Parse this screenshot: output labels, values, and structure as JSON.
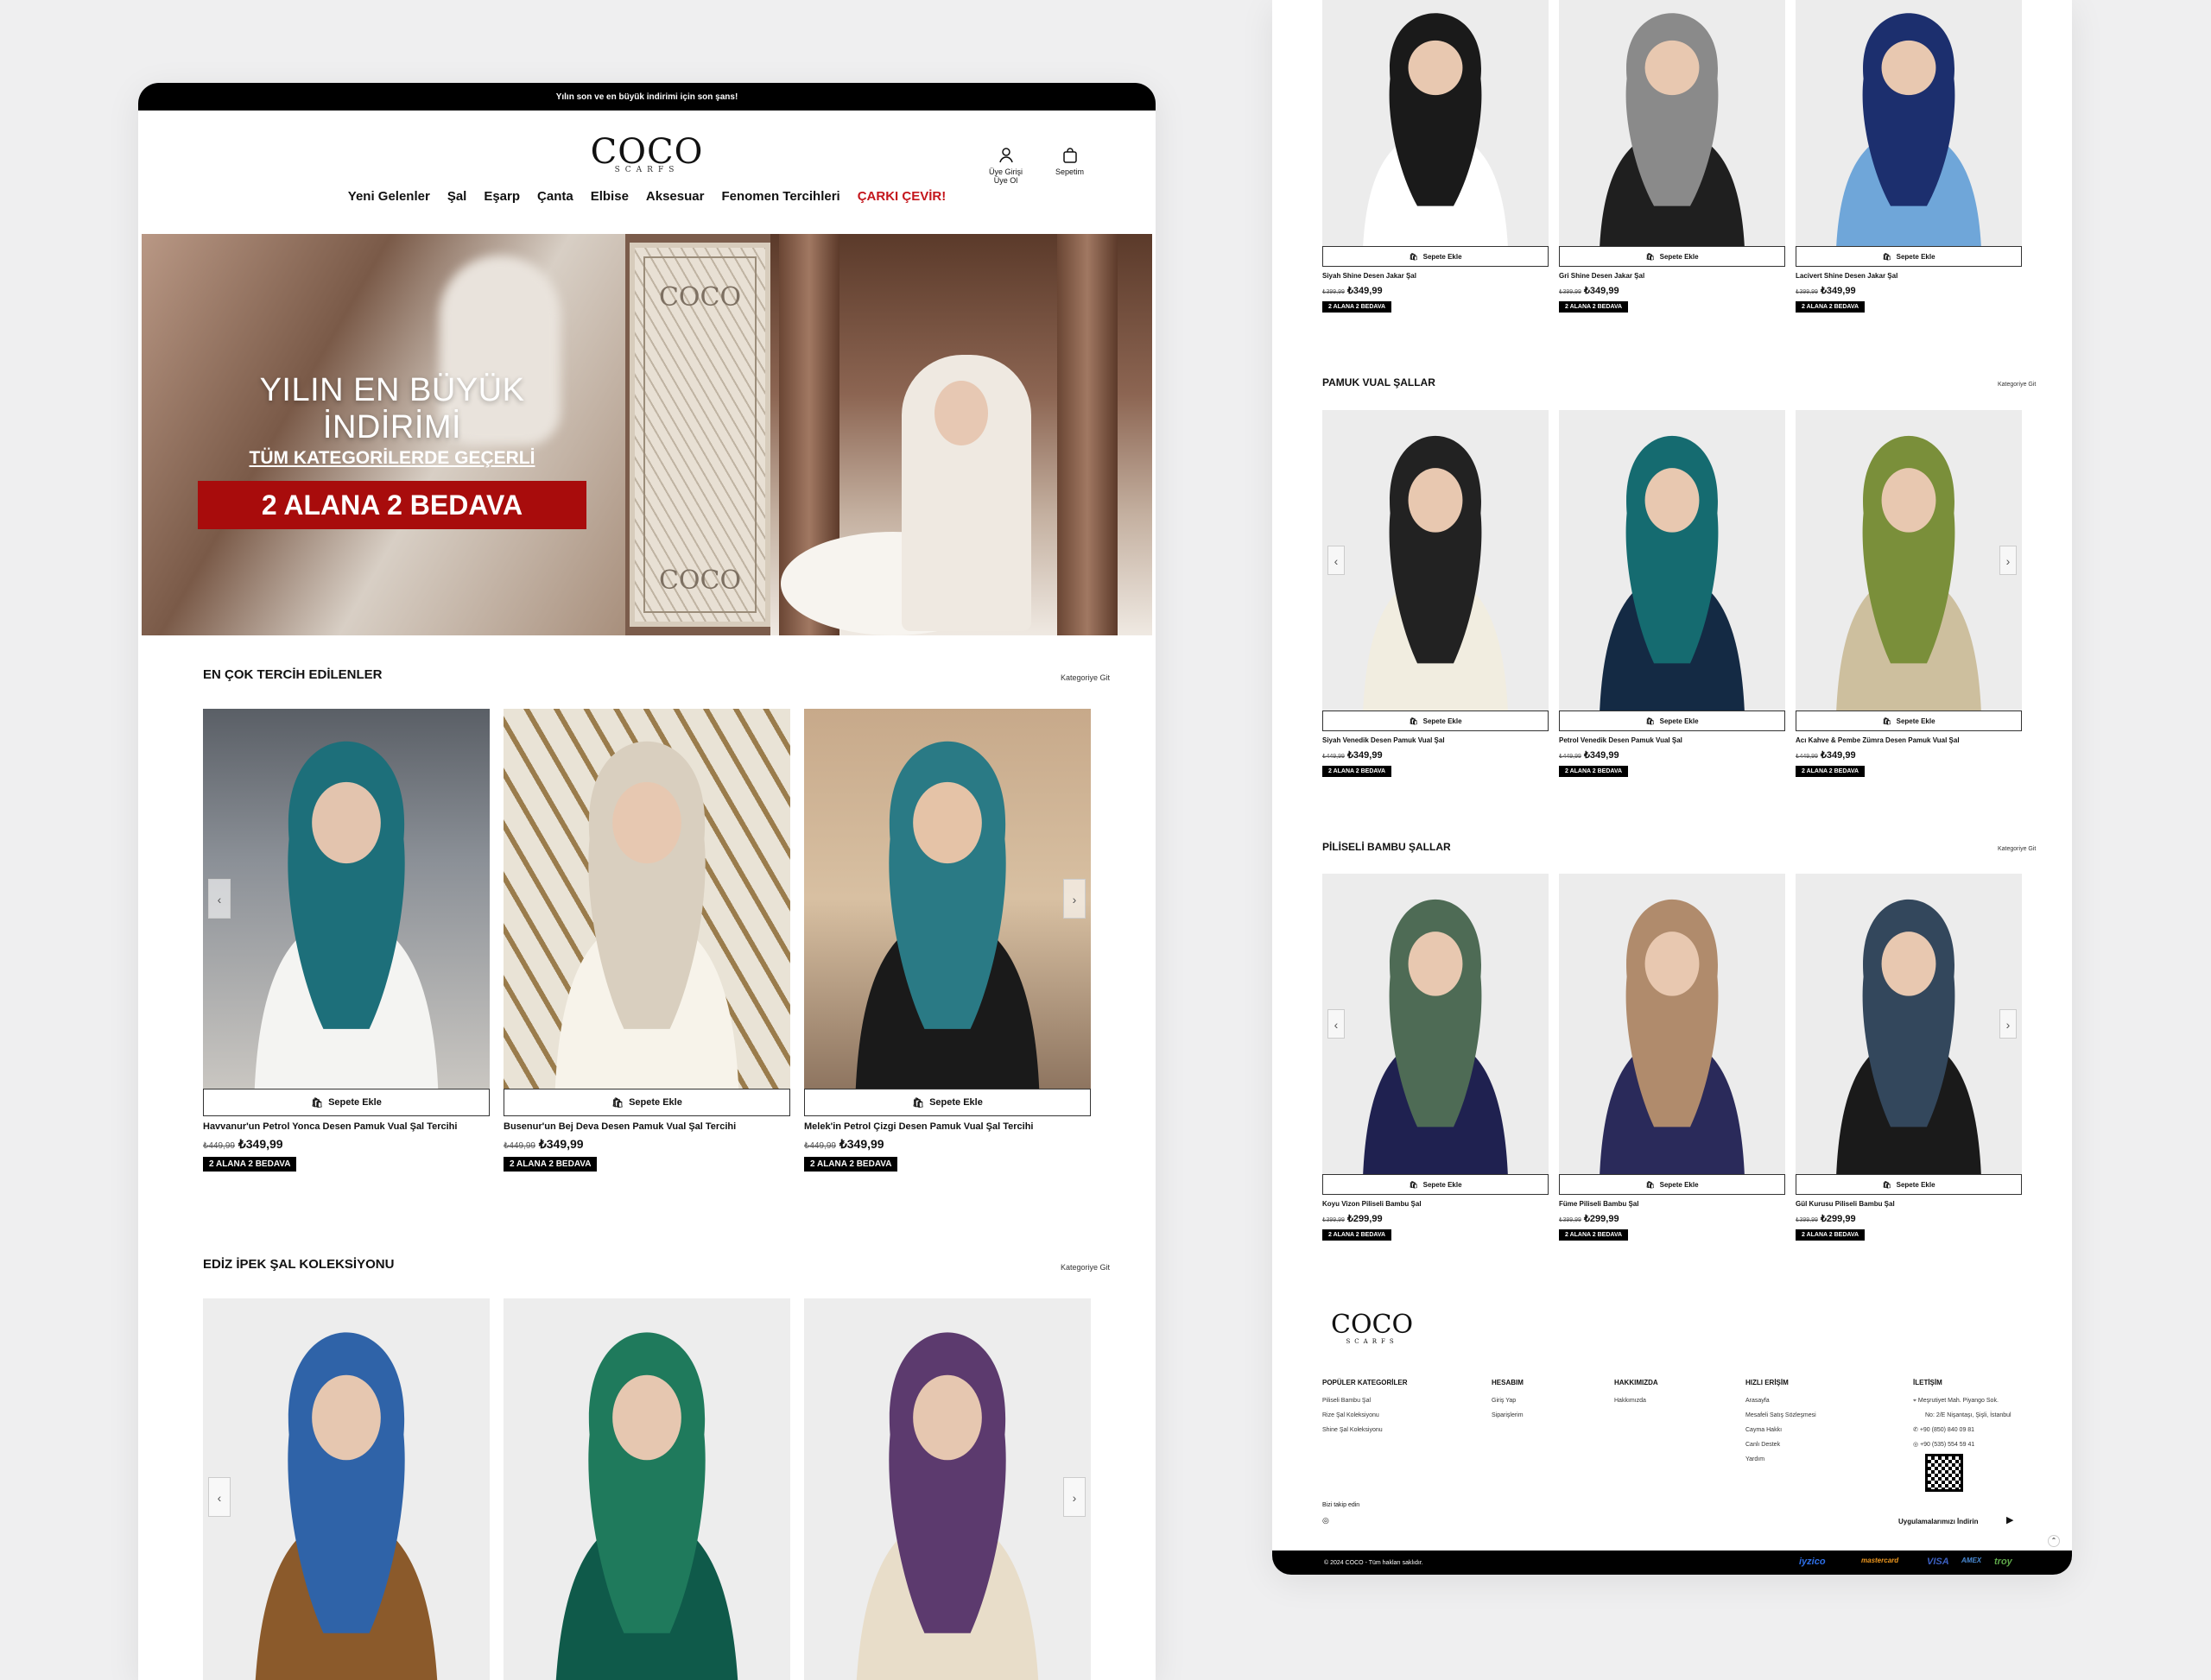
{
  "announcement": "Yılın son ve en büyük indirimi için son şans!",
  "brand": {
    "name": "COCO",
    "tagline": "SCARFS"
  },
  "header": {
    "account_label_1": "Üye Girişi",
    "account_label_2": "Üye Ol",
    "cart_label": "Sepetim"
  },
  "nav": [
    "Yeni Gelenler",
    "Şal",
    "Eşarp",
    "Çanta",
    "Elbise",
    "Aksesuar",
    "Fenomen Tercihleri",
    "ÇARKI ÇEVİR!"
  ],
  "hero": {
    "line1": "YILIN EN BÜYÜK İNDİRİMİ",
    "line2": "TÜM KATEGORİLERDE GEÇERLİ",
    "line3": "2 ALANA 2 BEDAVA",
    "scarf_mark": "COCO"
  },
  "common": {
    "add_to_cart": "Sepete Ekle",
    "badge": "2 ALANA 2 BEDAVA",
    "category_link": "Kategoriye Git",
    "currency": "₺"
  },
  "sections_left": [
    {
      "title": "EN ÇOK TERCİH EDİLENLER",
      "products": [
        {
          "name": "Havvanur'un Petrol Yonca Desen Pamuk Vual Şal Tercihi",
          "old_price": "₺449,99",
          "price": "₺349,99"
        },
        {
          "name": "Busenur'un Bej Deva Desen Pamuk Vual Şal Tercihi",
          "old_price": "₺449,99",
          "price": "₺349,99"
        },
        {
          "name": "Melek'in Petrol Çizgi Desen Pamuk Vual Şal Tercihi",
          "old_price": "₺449,99",
          "price": "₺349,99"
        }
      ]
    },
    {
      "title": "EDİZ İPEK ŞAL KOLEKSİYONU",
      "products": []
    }
  ],
  "top_row": [
    {
      "name": "Siyah Shine Desen Jakar Şal",
      "old_price": "₺399,99",
      "price": "₺349,99"
    },
    {
      "name": "Gri Shine Desen Jakar Şal",
      "old_price": "₺399,99",
      "price": "₺349,99"
    },
    {
      "name": "Lacivert Shine Desen Jakar Şal",
      "old_price": "₺399,99",
      "price": "₺349,99"
    }
  ],
  "sections_right": [
    {
      "title": "PAMUK VUAL ŞALLAR",
      "products": [
        {
          "name": "Siyah Venedik Desen Pamuk Vual Şal",
          "old_price": "₺449,99",
          "price": "₺349,99"
        },
        {
          "name": "Petrol Venedik Desen Pamuk Vual Şal",
          "old_price": "₺449,99",
          "price": "₺349,99"
        },
        {
          "name": "Acı Kahve & Pembe Zümra Desen Pamuk Vual Şal",
          "old_price": "₺449,99",
          "price": "₺349,99"
        }
      ]
    },
    {
      "title": "PİLİSELİ BAMBU ŞALLAR",
      "products": [
        {
          "name": "Koyu Vizon Piliseli Bambu Şal",
          "old_price": "₺399,99",
          "price": "₺299,99"
        },
        {
          "name": "Füme Piliseli Bambu Şal",
          "old_price": "₺399,99",
          "price": "₺299,99"
        },
        {
          "name": "Gül Kurusu Piliseli Bambu Şal",
          "old_price": "₺399,99",
          "price": "₺299,99"
        }
      ]
    }
  ],
  "footer": {
    "columns": [
      {
        "title": "POPÜLER KATEGORİLER",
        "items": [
          "Piliseli Bambu Şal",
          "Rize Şal Koleksiyonu",
          "Shine Şal Koleksiyonu"
        ]
      },
      {
        "title": "HESABIM",
        "items": [
          "Giriş Yap",
          "Siparişlerim"
        ]
      },
      {
        "title": "HAKKIMIZDA",
        "items": [
          "Hakkımızda"
        ]
      },
      {
        "title": "HIZLI ERİŞİM",
        "items": [
          "Arasayfa",
          "Mesafeli Satış Sözleşmesi",
          "Cayma Hakkı",
          "Canlı Destek",
          "Yardım"
        ]
      },
      {
        "title": "İLETİŞİM",
        "items": [
          "Meşrutiyet Mah. Piyango Sok.",
          "No: 2/E Nişantaşı, Şişli, İstanbul",
          "+90 (850) 840 09 81",
          "+90 (535) 554 59 41"
        ]
      }
    ],
    "follow": "Bizi takip edin",
    "app_download": "Uygulamalarımızı İndirin",
    "copyright": "© 2024 COCO - Tüm hakları saklıdır.",
    "payment": [
      "iyzico",
      "mastercard",
      "VISA",
      "AMEX",
      "troy"
    ]
  }
}
